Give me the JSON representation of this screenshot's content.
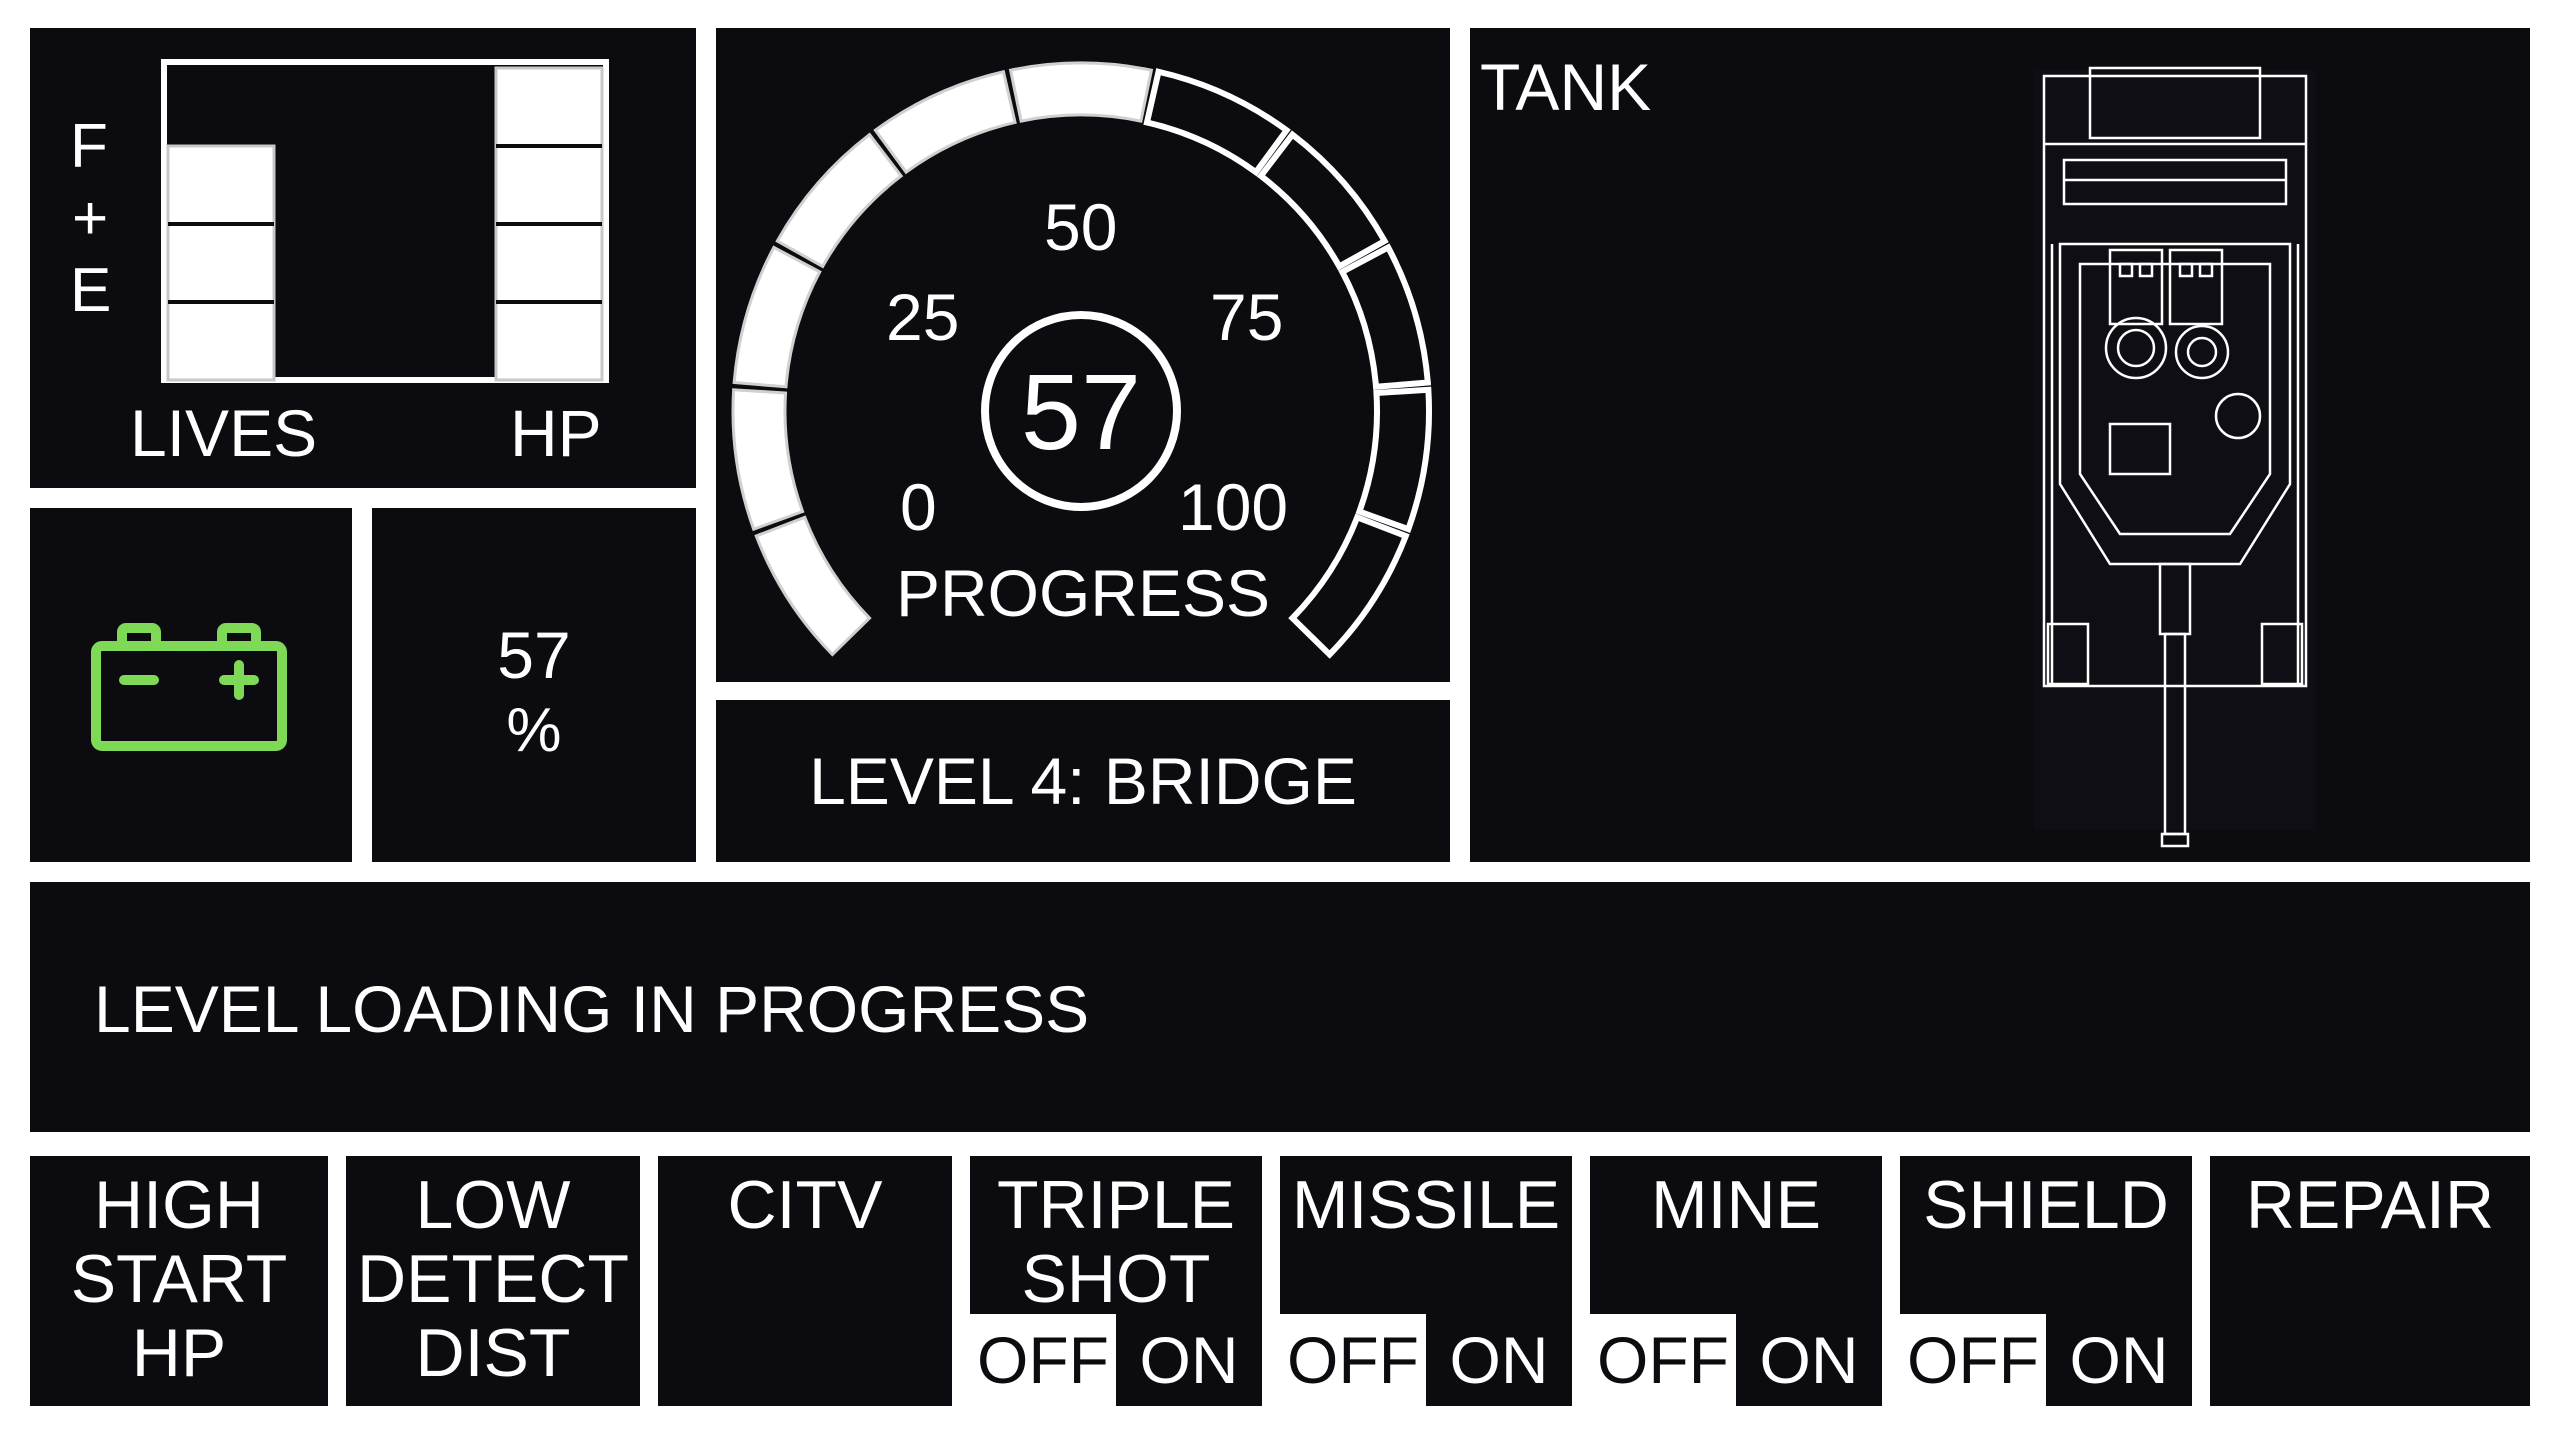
{
  "status_panel": {
    "fe_letters": [
      "F",
      "+",
      "E"
    ],
    "lives_label": "LIVES",
    "hp_label": "HP",
    "lives": {
      "filled": 3,
      "total": 4
    },
    "hp": {
      "filled": 4,
      "total": 4
    }
  },
  "battery": {
    "icon": "battery-icon",
    "color": "#7ed957",
    "percent_value": "57",
    "percent_unit": "%"
  },
  "gauge": {
    "ticks": [
      "0",
      "25",
      "50",
      "75",
      "100"
    ],
    "value": 57,
    "value_text": "57",
    "label": "PROGRESS",
    "min": 0,
    "max": 100
  },
  "level": {
    "title": "LEVEL 4: BRIDGE"
  },
  "tank": {
    "label": "TANK",
    "image": "tank-top-view-icon"
  },
  "message": {
    "text": "LEVEL LOADING IN PROGRESS"
  },
  "buttons": [
    {
      "id": "high-start-hp",
      "label": "HIGH\nSTART\nHP"
    },
    {
      "id": "low-detect-dist",
      "label": "LOW\nDETECT\nDIST"
    },
    {
      "id": "citv",
      "label": "CITV"
    },
    {
      "id": "triple-shot",
      "label": "TRIPLE\nSHOT",
      "off": "OFF",
      "on": "ON"
    },
    {
      "id": "missile",
      "label": "MISSILE",
      "off": "OFF",
      "on": "ON"
    },
    {
      "id": "mine",
      "label": "MINE",
      "off": "OFF",
      "on": "ON"
    },
    {
      "id": "shield",
      "label": "SHIELD",
      "off": "OFF",
      "on": "ON"
    },
    {
      "id": "repair",
      "label": "REPAIR"
    }
  ],
  "colors": {
    "panel": "#0c0b10",
    "frame": "#ffffff",
    "battery": "#7ed957"
  }
}
